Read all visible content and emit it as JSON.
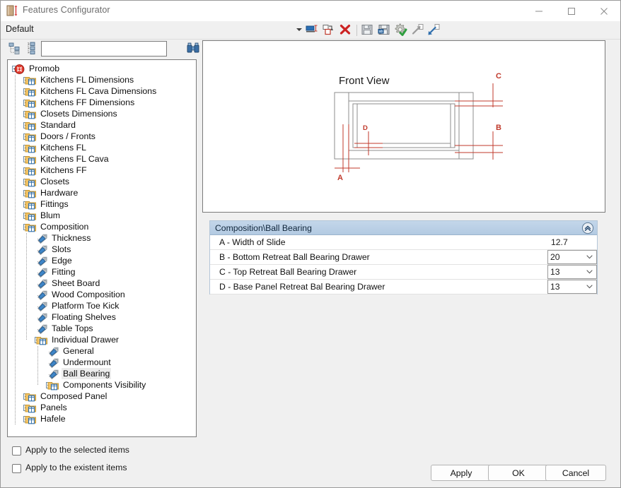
{
  "window": {
    "title": "Features Configurator",
    "app_icon": "cabinet-dimension-icon",
    "controls": {
      "minimize": "minimize-icon",
      "maximize": "maximize-icon",
      "close": "close-icon"
    }
  },
  "commandbar": {
    "profile_value": "Default",
    "profile_dropdown": "chevron-down-icon",
    "tools": [
      {
        "name": "insert-field-icon",
        "title": "Insert Field"
      },
      {
        "name": "duplicate-icon",
        "title": "Duplicate"
      },
      {
        "name": "delete-red-x-icon",
        "title": "Delete"
      },
      {
        "name": "save-icon",
        "title": "Save"
      },
      {
        "name": "save-as-icon",
        "title": "Save As"
      },
      {
        "name": "settings-check-icon",
        "title": "Apply Settings"
      },
      {
        "name": "export-arrow-icon",
        "title": "Export"
      },
      {
        "name": "import-arrow-icon",
        "title": "Import"
      }
    ]
  },
  "tree_toolbar": {
    "collapse_all_icon": "collapse-all-icon",
    "expand_all_icon": "expand-all-icon",
    "search_value": "",
    "search_placeholder": "",
    "find_icon": "binoculars-find-icon"
  },
  "tree": {
    "nodes": [
      {
        "label": "Promob",
        "depth": 0,
        "icon": "promob-logo-icon",
        "toggle": "minus",
        "selected": false
      },
      {
        "label": "Kitchens FL Dimensions",
        "depth": 1,
        "icon": "folder-table-icon",
        "toggle": "plus",
        "selected": false
      },
      {
        "label": "Kitchens FL Cava Dimensions",
        "depth": 1,
        "icon": "folder-table-icon",
        "toggle": "plus",
        "selected": false
      },
      {
        "label": "Kitchens FF Dimensions",
        "depth": 1,
        "icon": "folder-table-icon",
        "toggle": "plus",
        "selected": false
      },
      {
        "label": "Closets Dimensions",
        "depth": 1,
        "icon": "folder-table-icon",
        "toggle": "plus",
        "selected": false
      },
      {
        "label": "Standard",
        "depth": 1,
        "icon": "folder-table-icon",
        "toggle": "plus",
        "selected": false
      },
      {
        "label": "Doors / Fronts",
        "depth": 1,
        "icon": "folder-table-icon",
        "toggle": "plus",
        "selected": false
      },
      {
        "label": "Kitchens FL",
        "depth": 1,
        "icon": "folder-table-icon",
        "toggle": "plus",
        "selected": false
      },
      {
        "label": "Kitchens FL Cava",
        "depth": 1,
        "icon": "folder-table-icon",
        "toggle": "plus",
        "selected": false
      },
      {
        "label": "Kitchens FF",
        "depth": 1,
        "icon": "folder-table-icon",
        "toggle": "plus",
        "selected": false
      },
      {
        "label": "Closets",
        "depth": 1,
        "icon": "folder-table-icon",
        "toggle": "plus",
        "selected": false
      },
      {
        "label": "Hardware",
        "depth": 1,
        "icon": "folder-table-icon",
        "toggle": "plus",
        "selected": false
      },
      {
        "label": "Fittings",
        "depth": 1,
        "icon": "folder-table-icon",
        "toggle": "plus",
        "selected": false
      },
      {
        "label": "Blum",
        "depth": 1,
        "icon": "folder-table-icon",
        "toggle": "plus",
        "selected": false
      },
      {
        "label": "Composition",
        "depth": 1,
        "icon": "folder-table-icon",
        "toggle": "minus",
        "selected": false
      },
      {
        "label": "Thickness",
        "depth": 2,
        "icon": "tag-icon",
        "toggle": "none",
        "selected": false
      },
      {
        "label": "Slots",
        "depth": 2,
        "icon": "tag-icon",
        "toggle": "none",
        "selected": false
      },
      {
        "label": "Edge",
        "depth": 2,
        "icon": "tag-icon",
        "toggle": "none",
        "selected": false
      },
      {
        "label": "Fitting",
        "depth": 2,
        "icon": "tag-icon",
        "toggle": "none",
        "selected": false
      },
      {
        "label": "Sheet Board",
        "depth": 2,
        "icon": "tag-icon",
        "toggle": "none",
        "selected": false
      },
      {
        "label": "Wood Composition",
        "depth": 2,
        "icon": "tag-icon",
        "toggle": "none",
        "selected": false
      },
      {
        "label": "Platform Toe Kick",
        "depth": 2,
        "icon": "tag-icon",
        "toggle": "none",
        "selected": false
      },
      {
        "label": "Floating Shelves",
        "depth": 2,
        "icon": "tag-icon",
        "toggle": "none",
        "selected": false
      },
      {
        "label": "Table Tops",
        "depth": 2,
        "icon": "tag-icon",
        "toggle": "none",
        "selected": false
      },
      {
        "label": "Individual Drawer",
        "depth": 2,
        "icon": "folder-table-icon",
        "toggle": "minus",
        "selected": false
      },
      {
        "label": "General",
        "depth": 3,
        "icon": "tag-icon",
        "toggle": "none",
        "selected": false
      },
      {
        "label": "Undermount",
        "depth": 3,
        "icon": "tag-icon",
        "toggle": "none",
        "selected": false
      },
      {
        "label": "Ball Bearing",
        "depth": 3,
        "icon": "tag-icon",
        "toggle": "none",
        "selected": true
      },
      {
        "label": "Components Visibility",
        "depth": 3,
        "icon": "folder-table-icon",
        "toggle": "plus",
        "selected": false
      },
      {
        "label": "Composed Panel",
        "depth": 1,
        "icon": "folder-table-icon",
        "toggle": "plus",
        "selected": false
      },
      {
        "label": "Panels",
        "depth": 1,
        "icon": "folder-table-icon",
        "toggle": "plus",
        "selected": false
      },
      {
        "label": "Hafele",
        "depth": 1,
        "icon": "folder-table-icon",
        "toggle": "plus",
        "selected": false
      }
    ]
  },
  "options": {
    "apply_selected": {
      "label": "Apply to the selected items",
      "checked": false
    },
    "apply_existent": {
      "label": "Apply to the existent items",
      "checked": false
    }
  },
  "preview": {
    "title": "Front View",
    "dimension_labels": [
      "A",
      "B",
      "C",
      "D"
    ],
    "annotation_color": "#c0392b",
    "line_color": "#7a7a7a"
  },
  "properties": {
    "header": "Composition\\Ball Bearing",
    "collapse_icon": "chevrons-up-circle-icon",
    "rows": [
      {
        "label": "A - Width of Slide",
        "value": "12.7",
        "editor": "text"
      },
      {
        "label": "B - Bottom Retreat Ball Bearing Drawer",
        "value": "20",
        "editor": "combo"
      },
      {
        "label": "C - Top Retreat Ball Bearing Drawer",
        "value": "13",
        "editor": "combo"
      },
      {
        "label": "D - Base Panel Retreat Bal Bearing Drawer",
        "value": "13",
        "editor": "combo"
      }
    ]
  },
  "footer": {
    "apply_label": "Apply",
    "ok_label": "OK",
    "cancel_label": "Cancel"
  }
}
